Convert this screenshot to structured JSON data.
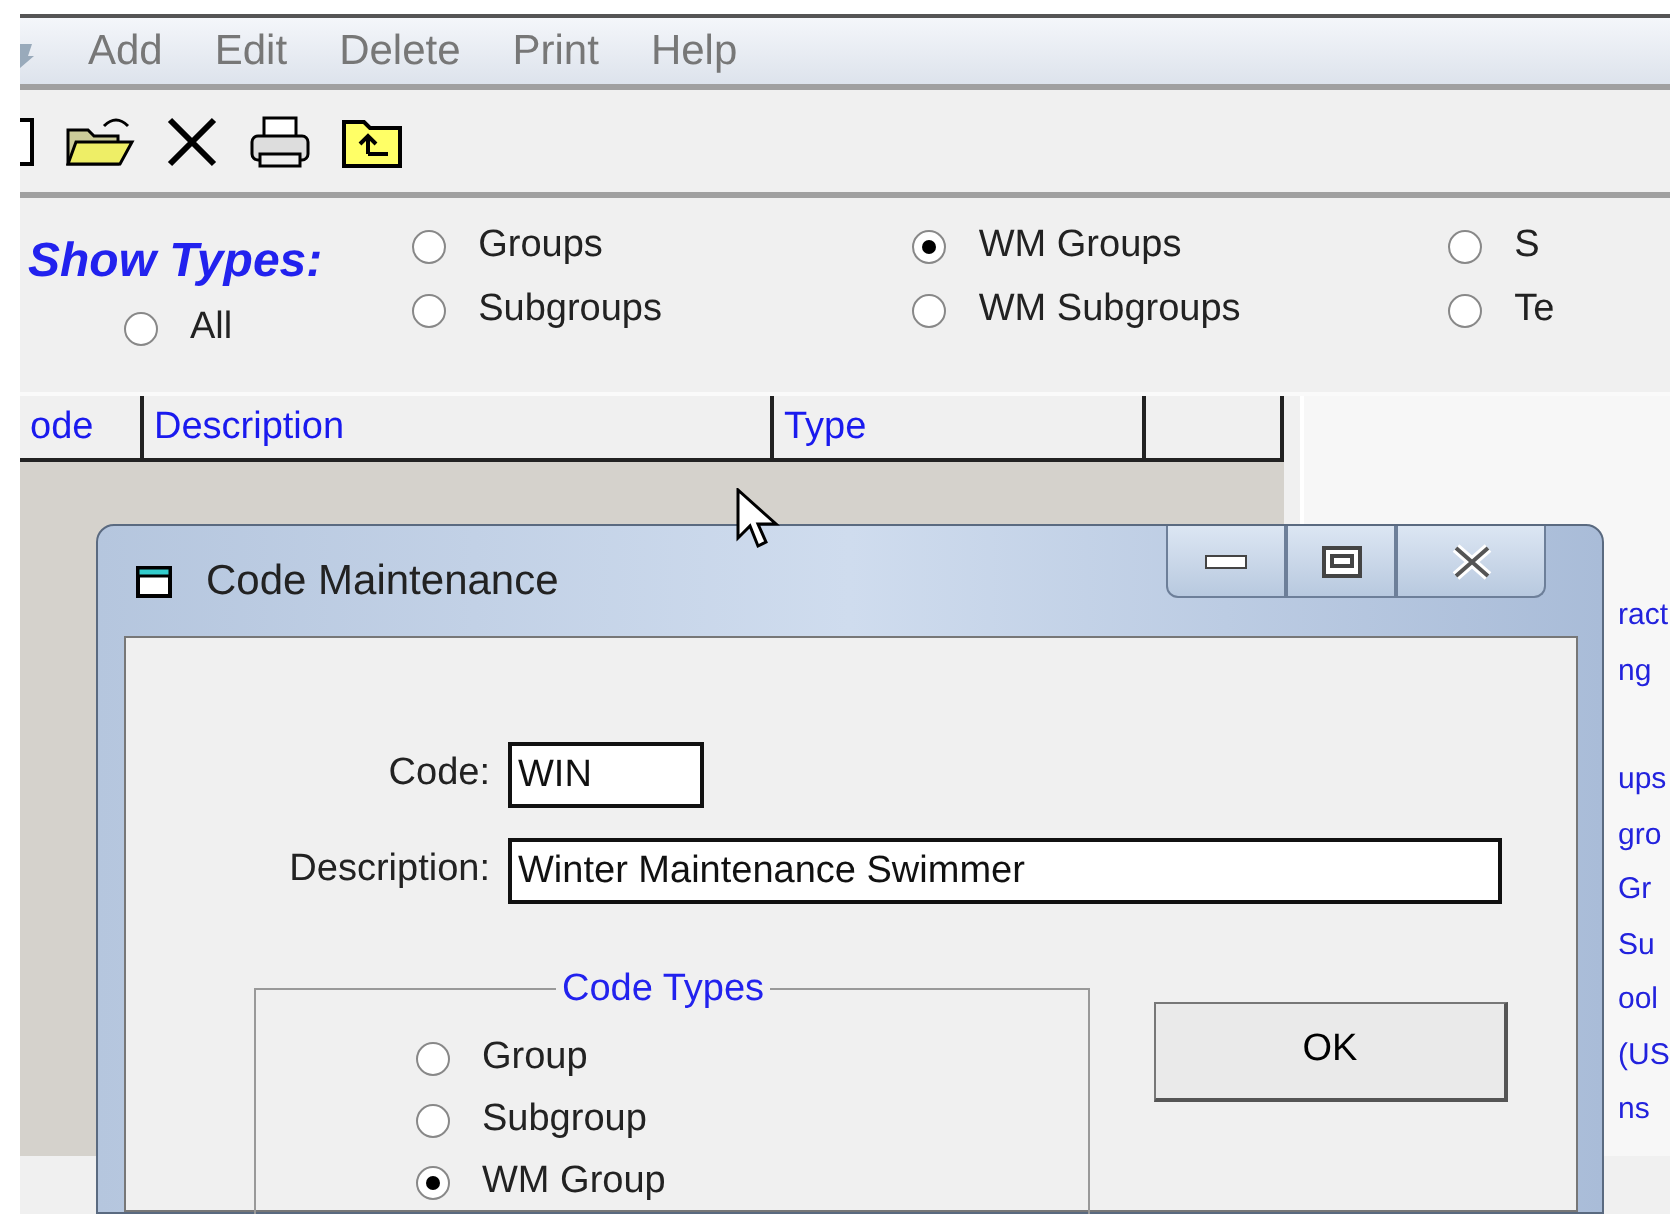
{
  "menu": [
    "Add",
    "Edit",
    "Delete",
    "Print",
    "Help"
  ],
  "filter": {
    "label": "Show Types:",
    "options": [
      {
        "label": "All",
        "selected": false
      },
      {
        "label": "Groups",
        "selected": false
      },
      {
        "label": "Subgroups",
        "selected": false
      },
      {
        "label": "WM Groups",
        "selected": true
      },
      {
        "label": "WM Subgroups",
        "selected": false
      },
      {
        "label": "S",
        "selected": false
      },
      {
        "label": "Te",
        "selected": false
      }
    ]
  },
  "table": {
    "columns": [
      "ode",
      "Description",
      "Type"
    ]
  },
  "side_panel": {
    "paragraphs": [
      [
        "ract",
        "ng"
      ],
      [
        "ups",
        "gro",
        "Gr",
        "Su",
        "ool",
        "(US",
        "ns"
      ]
    ]
  },
  "dialog": {
    "title": "Code Maintenance",
    "fields": [
      {
        "label": "Code:",
        "value": "WIN"
      },
      {
        "label": "Description:",
        "value": "Winter Maintenance Swimmer"
      }
    ],
    "code_types": {
      "legend": "Code Types",
      "options": [
        {
          "label": "Group",
          "selected": false
        },
        {
          "label": "Subgroup",
          "selected": false
        },
        {
          "label": "WM Group",
          "selected": true
        }
      ]
    },
    "buttons": [
      "OK"
    ]
  }
}
